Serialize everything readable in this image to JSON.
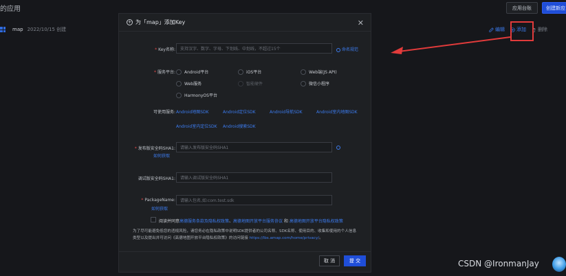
{
  "background": {
    "title": "的应用",
    "buttons": {
      "app_console": "应用台账",
      "create_app": "创建新应"
    },
    "app_row": {
      "name": "map",
      "date": "2022/10/15 创建"
    },
    "actions": {
      "edit": "编辑",
      "add": "添加",
      "delete": "删除"
    }
  },
  "modal": {
    "title": "为「map」添加Key",
    "key_name": {
      "label": "Key名称:",
      "placeholder": "支持汉字、数字、字母、下划线、中划线，不超过15个",
      "help_link": "命名规范"
    },
    "service_platform": {
      "label": "服务平台:",
      "options": [
        "Android平台",
        "iOS平台",
        "Web端(JS API)",
        "Web服务",
        "智能硬件",
        "微信小程序",
        "HarmonyOS平台"
      ]
    },
    "available_services": {
      "label": "可使用服务:",
      "items": [
        "Android地图SDK",
        "Android定位SDK",
        "Android导航SDK",
        "Android室内地图SDK",
        "Android室内定位SDK",
        "Android搜索SDK"
      ]
    },
    "release_sha1": {
      "label": "发布版安全码SHA1:",
      "placeholder": "请输入发布版安全码SHA1",
      "how_to": "如何获取"
    },
    "debug_sha1": {
      "label": "调试版安全码SHA1:",
      "placeholder": "请输入调试版安全码SHA1"
    },
    "package_name": {
      "label": "PackageName:",
      "placeholder": "请输入包名,如:com.test.sdk",
      "how_to": "如何获取"
    },
    "agreement": {
      "prefix": "阅读并同意",
      "link1": "高德服务条款及隐私权政策",
      "sep1": "、",
      "link2": "高德地图开放平台服务协议",
      "sep2": " 和 ",
      "link3": "高德地图开放平台隐私权政策"
    },
    "note": {
      "text": "为了尽可能避免低您的违规风险，请您务必在隐私政策中说明SDK提供者的公司名称、SDK名称、使用目的、收集和使用的个人信息类型以及提出并可访问《高德地图开放平台隐私权政策》的访问链接",
      "url": "https://lbs.amap.com/home/privacy/",
      "end": "。"
    },
    "buttons": {
      "cancel": "取 消",
      "submit": "提 交"
    }
  },
  "watermark": "CSDN @IronmanJay",
  "colors": {
    "accent": "#3c7cf0",
    "primary_button": "#1f4ed8",
    "highlight": "#e23b3b"
  }
}
